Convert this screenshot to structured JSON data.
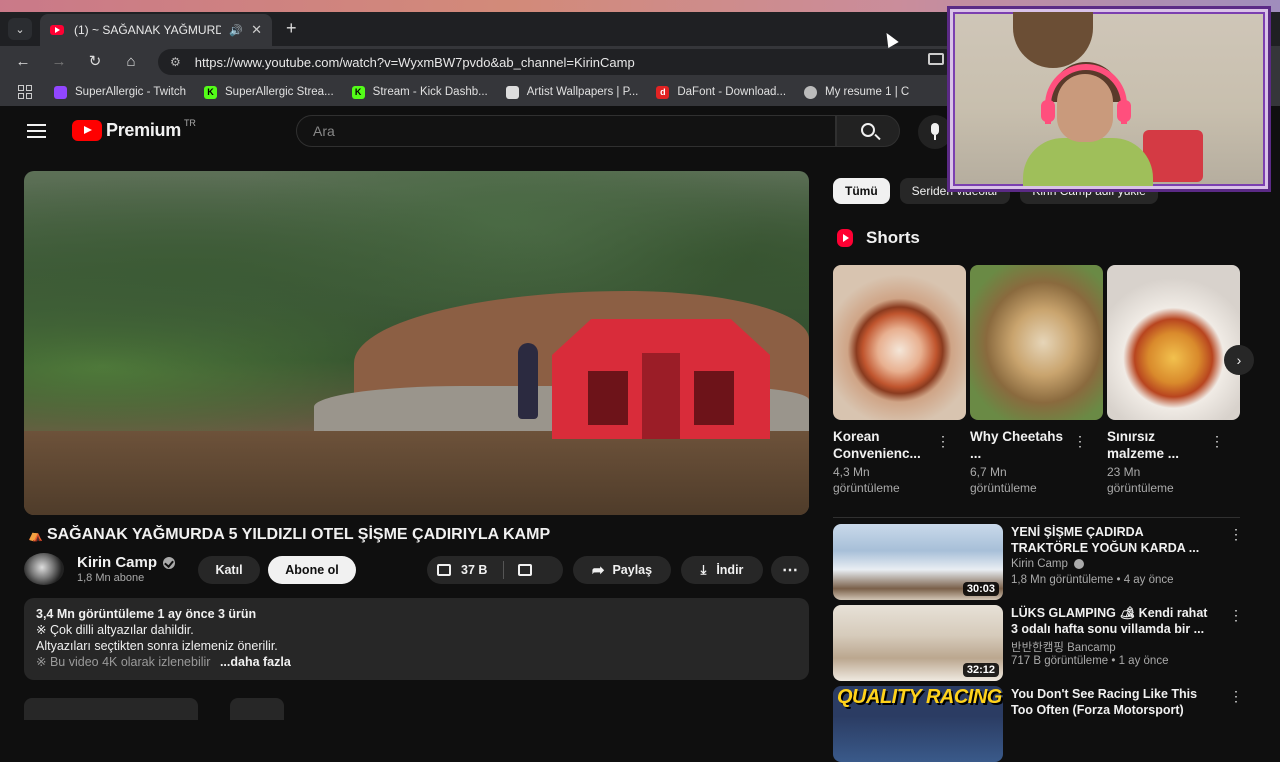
{
  "browser": {
    "tab": {
      "title": "(1) ~ SAĞANAK YAĞMURD...",
      "close": "✕"
    },
    "new_tab": "+",
    "url": "https://www.youtube.com/watch?v=WyxmBW7pvdo&ab_channel=KirinCamp",
    "bookmarks": [
      {
        "label": "SuperAllergic - Twitch",
        "icon": "twitch-icon",
        "color": "#9146ff"
      },
      {
        "label": "SuperAllergic Strea...",
        "icon": "kick-icon",
        "color": "#53fc18"
      },
      {
        "label": "Stream - Kick Dashb...",
        "icon": "kick-icon",
        "color": "#53fc18"
      },
      {
        "label": "Artist Wallpapers | P...",
        "icon": "image-icon",
        "color": "#dddddd"
      },
      {
        "label": "DaFont - Download...",
        "icon": "dafont-icon",
        "color": "#e22323"
      },
      {
        "label": "My resume 1 | C",
        "icon": "globe-icon",
        "color": "#bbbbbb"
      }
    ]
  },
  "youtube": {
    "logo_text": "Premium",
    "logo_region": "TR",
    "search_placeholder": "Ara",
    "video": {
      "title": "SAĞANAK YAĞMURDA 5 YILDIZLI OTEL ŞİŞME ÇADIRIYLA KAMP",
      "channel": "Kirin Camp",
      "subscribers": "1,8 Mn abone",
      "join_label": "Katıl",
      "subscribe_label": "Abone ol",
      "likes": "37 B",
      "share_label": "Paylaş",
      "download_label": "İndir",
      "more_label": "⋯",
      "description": {
        "meta": "3,4 Mn görüntüleme  1 ay önce  3 ürün",
        "line1": "※ Çok dilli altyazılar dahildir.",
        "line2": "Altyazıları seçtikten sonra izlemeniz önerilir.",
        "line3": "※ Bu video 4K olarak izlenebilir",
        "more": "...daha fazla"
      }
    },
    "chips": [
      "Tümü",
      "Seriden videolar",
      "Kirin Camp adlı yükle"
    ],
    "shorts_title": "Shorts",
    "shorts": [
      {
        "title": "Korean Convenienc...",
        "views": "4,3 Mn",
        "views_suffix": "görüntüleme"
      },
      {
        "title": "Why Cheetahs ...",
        "views": "6,7 Mn",
        "views_suffix": "görüntüleme"
      },
      {
        "title": "Sınırsız malzeme ...",
        "views": "23 Mn",
        "views_suffix": "görüntüleme"
      }
    ],
    "recommendations": [
      {
        "title1": "YENİ ŞİŞME ÇADIRDA",
        "title2": "TRAKTÖRLE YOĞUN KARDA ...",
        "channel": "Kirin Camp",
        "verified": true,
        "meta": "1,8 Mn görüntüleme • 4 ay önce",
        "duration": "30:03"
      },
      {
        "title1": "LÜKS GLAMPING 🏕 Kendi rahat",
        "title2": "3 odalı hafta sonu villamda bir ...",
        "channel": "반반한캠핑 Bancamp",
        "verified": false,
        "meta": "717 B görüntüleme • 1 ay önce",
        "duration": "32:12"
      },
      {
        "title1": "You Don't See Racing Like This",
        "title2": "Too Often (Forza Motorsport)",
        "channel": "",
        "verified": false,
        "meta": "",
        "duration": "",
        "thumb_text": "QUALITY RACING"
      }
    ]
  }
}
